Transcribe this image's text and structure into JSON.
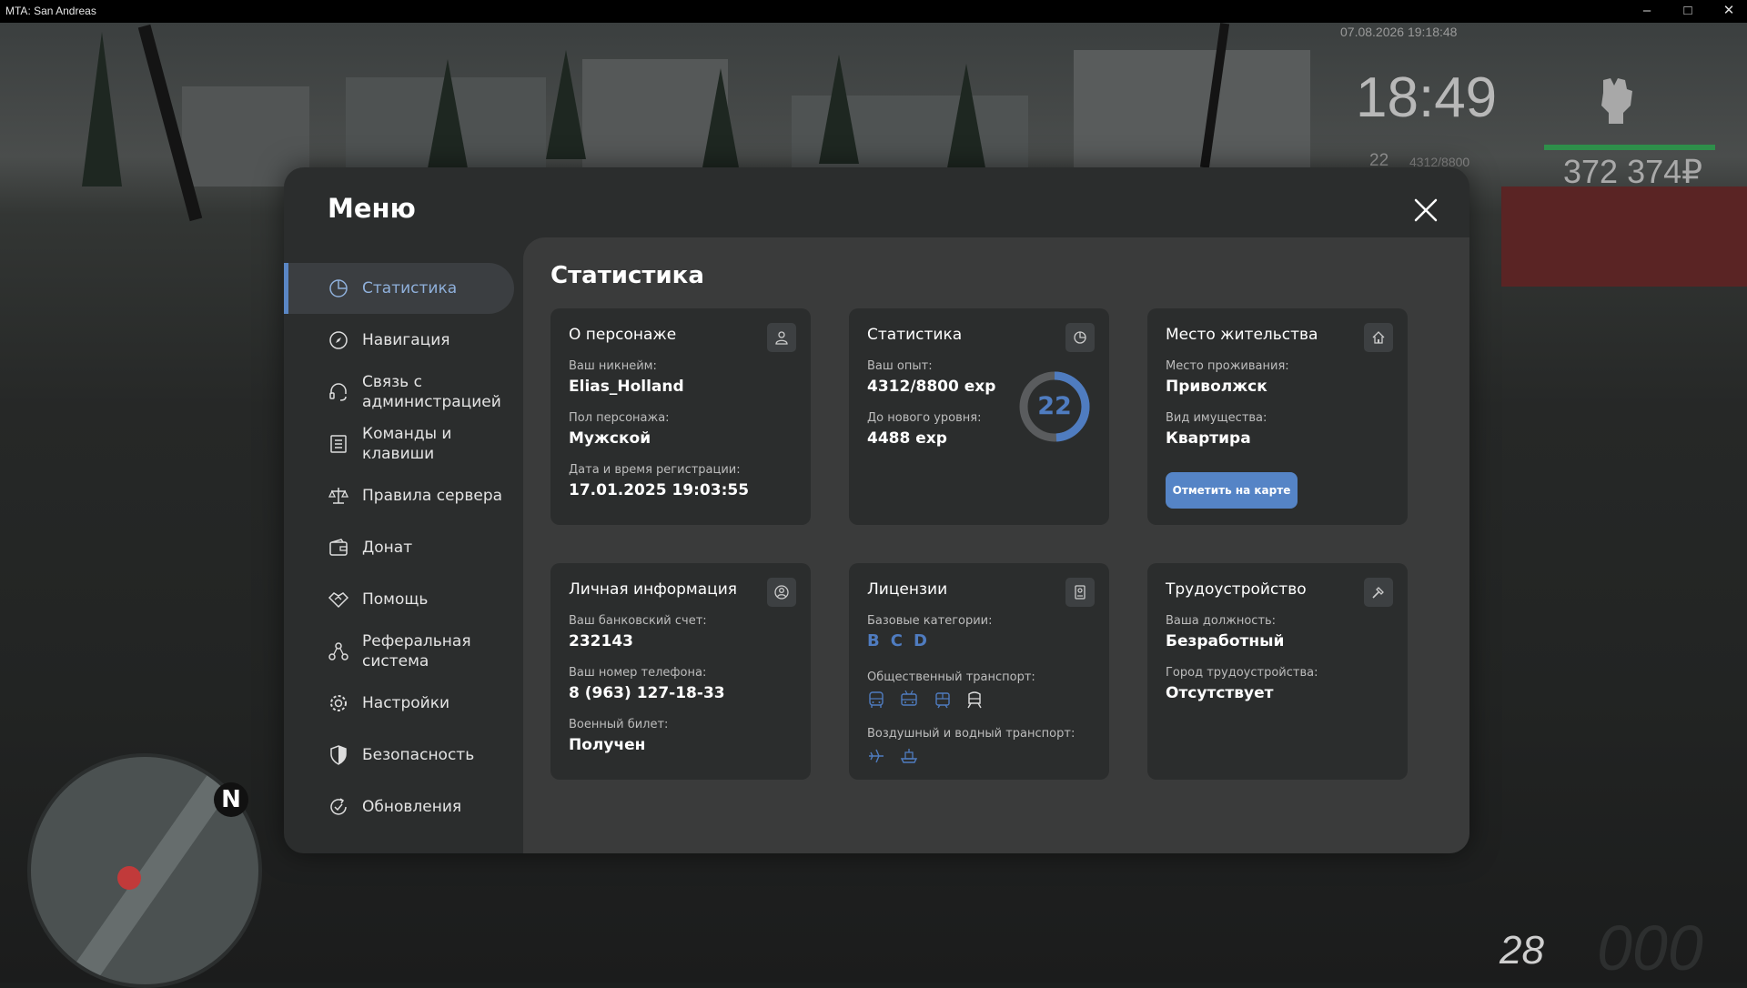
{
  "window": {
    "title": "MTA: San Andreas",
    "minimize": "–",
    "maximize": "□",
    "close": "✕"
  },
  "hud": {
    "datetime": "07.08.2026 19:18:48",
    "time": "18:49",
    "level": "22",
    "exp": "4312/8800",
    "money": "372 374₽",
    "speed": "28",
    "speed_bg": "000",
    "compass": "N"
  },
  "menu": {
    "title": "Меню",
    "close_icon": "close-icon",
    "sidebar": [
      {
        "label": "Статистика",
        "icon": "stats-pie-icon",
        "active": true
      },
      {
        "label": "Навигация",
        "icon": "compass-icon"
      },
      {
        "label": "Связь с администрацией",
        "icon": "headset-icon"
      },
      {
        "label": "Команды и клавиши",
        "icon": "list-icon"
      },
      {
        "label": "Правила сервера",
        "icon": "scales-icon"
      },
      {
        "label": "Донат",
        "icon": "wallet-icon"
      },
      {
        "label": "Помощь",
        "icon": "handshake-icon"
      },
      {
        "label": "Реферальная система",
        "icon": "referral-icon"
      },
      {
        "label": "Настройки",
        "icon": "gear-icon"
      },
      {
        "label": "Безопасность",
        "icon": "shield-icon"
      },
      {
        "label": "Обновления",
        "icon": "update-icon"
      }
    ]
  },
  "content": {
    "title": "Статистика",
    "about": {
      "title": "О персонаже",
      "nick_label": "Ваш никнейм:",
      "nick": "Elias_Holland",
      "gender_label": "Пол персонажа:",
      "gender": "Мужской",
      "reg_label": "Дата и время регистрации:",
      "reg": "17.01.2025 19:03:55"
    },
    "stats": {
      "title": "Статистика",
      "exp_label": "Ваш опыт:",
      "exp": "4312/8800 exp",
      "next_label": "До нового уровня:",
      "next": "4488 exp",
      "level": "22",
      "progress": 0.49
    },
    "residence": {
      "title": "Место жительства",
      "place_label": "Место проживания:",
      "place": "Приволжск",
      "property_label": "Вид имущества:",
      "property": "Квартира",
      "button": "Отметить на карте"
    },
    "personal": {
      "title": "Личная информация",
      "bank_label": "Ваш банковский счет:",
      "bank": "232143",
      "phone_label": "Ваш номер телефона:",
      "phone": "8 (963) 127-18-33",
      "military_label": "Военный билет:",
      "military": "Получен"
    },
    "licenses": {
      "title": "Лицензии",
      "base_label": "Базовые категории:",
      "base": [
        "B",
        "C",
        "D"
      ],
      "public_label": "Общественный транспорт:",
      "public_icons": [
        "bus-icon",
        "trolleybus-icon",
        "tram-icon",
        "train-icon"
      ],
      "air_label": "Воздушный и водный транспорт:",
      "air_icons": [
        "plane-icon",
        "boat-icon"
      ]
    },
    "employment": {
      "title": "Трудоустройство",
      "position_label": "Ваша должность:",
      "position": "Безработный",
      "city_label": "Город трудоустройства:",
      "city": "Отсутствует"
    }
  },
  "colors": {
    "accent": "#5584c6",
    "panel": "#2b2d2d",
    "content": "#3a3b3b"
  }
}
